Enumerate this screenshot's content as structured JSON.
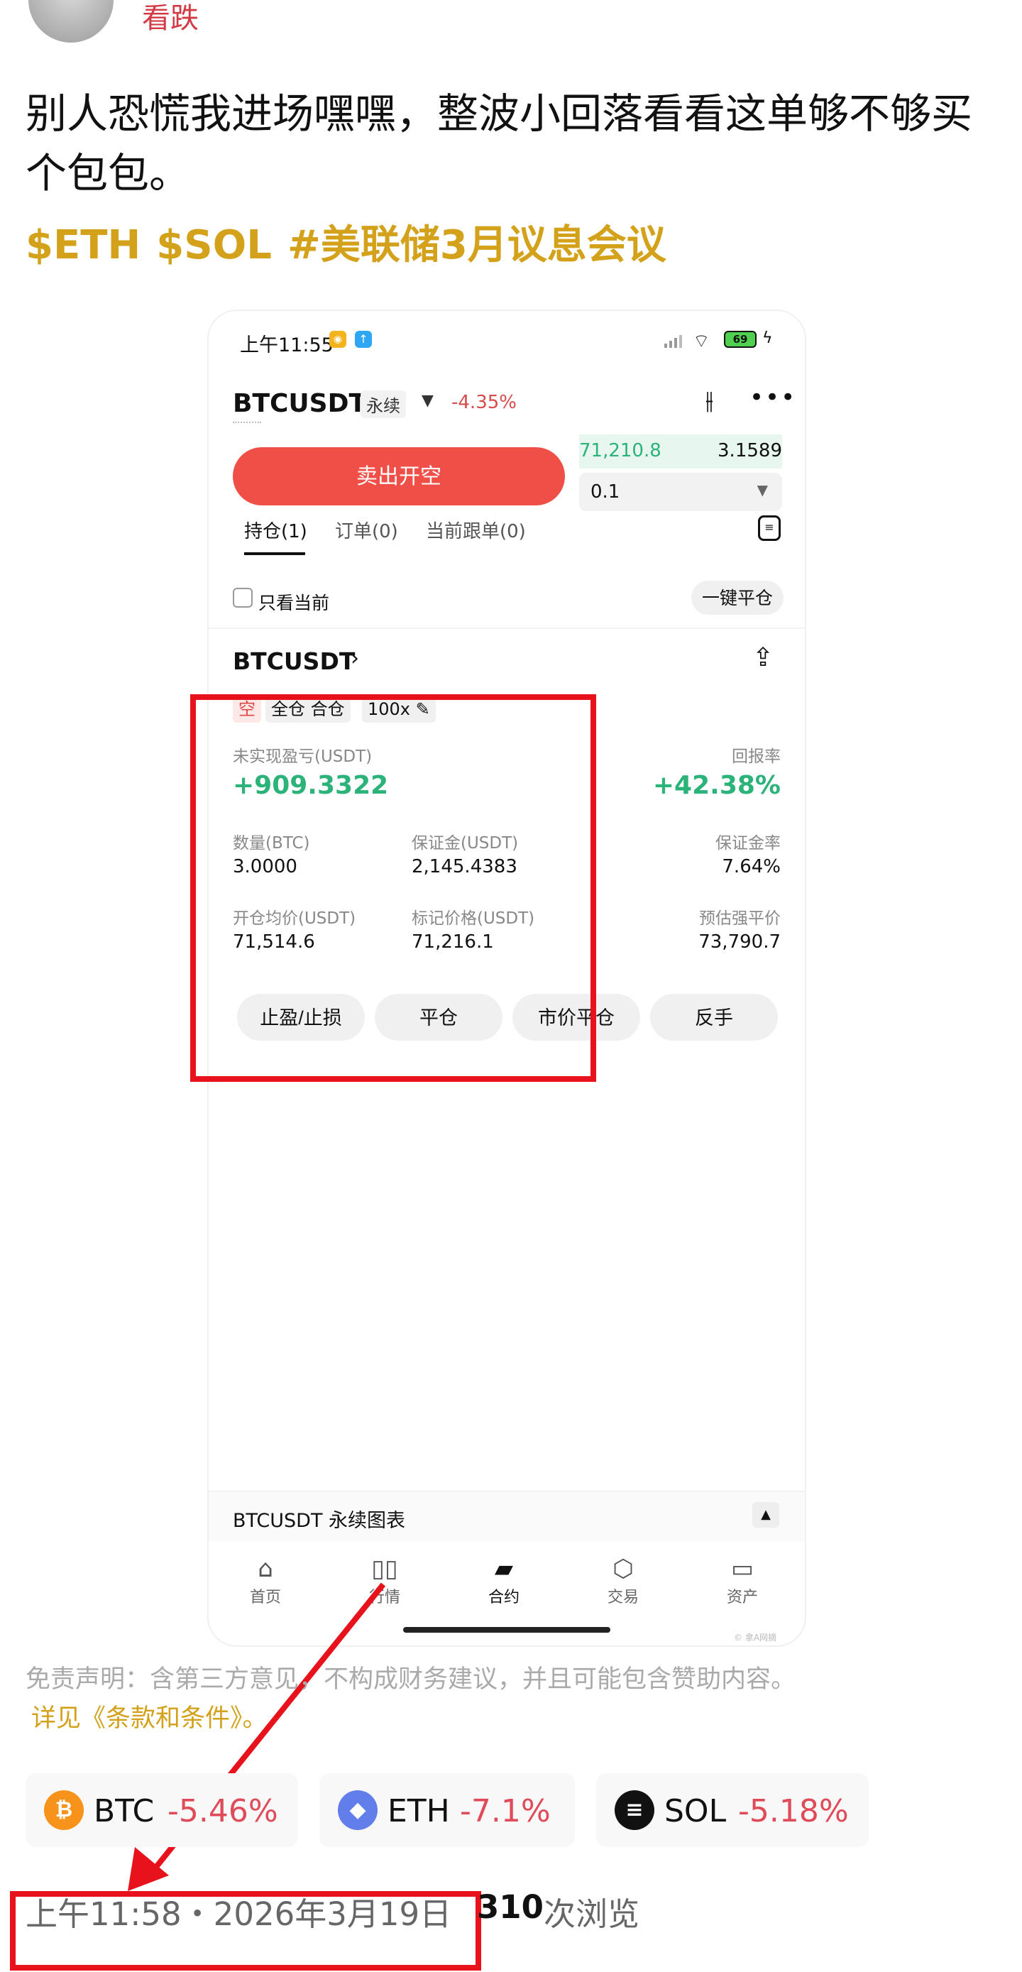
{
  "post": {
    "author": "看跌",
    "text": "别人恐慌我进场嘿嘿，整波小回落看看这单够不够买个包包。",
    "tags": [
      "$ETH",
      "$SOL",
      "#美联储3月议息会议"
    ]
  },
  "phone": {
    "status_time": "上午11:55",
    "battery": "69",
    "header": {
      "pair": "BTCUSDT",
      "type": "永续",
      "change": "-4.35%"
    },
    "orderbook": {
      "price": "71,210.8",
      "qty": "3.1589"
    },
    "sell_button": "卖出开空",
    "qty_value": "0.1",
    "tabs": [
      "持仓(1)",
      "订单(0)",
      "当前跟单(0)"
    ],
    "only_current": "只看当前",
    "close_all": "一键平仓",
    "position": {
      "symbol": "BTCUSDT",
      "side": "空",
      "margin_mode": "全仓 合仓",
      "leverage": "100x",
      "unrealized_label": "未实现盈亏(USDT)",
      "unrealized_value": "+909.3322",
      "roe_label": "回报率",
      "roe_value": "+42.38%",
      "qty_label": "数量(BTC)",
      "qty_value": "3.0000",
      "margin_label": "保证金(USDT)",
      "margin_value": "2,145.4383",
      "margin_ratio_label": "保证金率",
      "margin_ratio_value": "7.64%",
      "entry_label": "开仓均价(USDT)",
      "entry_value": "71,514.6",
      "mark_label": "标记价格(USDT)",
      "mark_value": "71,216.1",
      "liq_label": "预估强平价",
      "liq_value": "73,790.7",
      "actions": [
        "止盈/止损",
        "平仓",
        "市价平仓",
        "反手"
      ]
    },
    "chart_label": "BTCUSDT 永续图表",
    "nav": [
      "首页",
      "行情",
      "合约",
      "交易",
      "资产"
    ],
    "watermark": "© 拿A网摘"
  },
  "disclaimer": "免责声明：含第三方意见，不构成财务建议，并且可能包含赞助内容。",
  "terms": "详见《条款和条件》。",
  "coins": [
    {
      "name": "BTC",
      "change": "-5.46%",
      "color": "#f7931a",
      "icon": "₿"
    },
    {
      "name": "ETH",
      "change": "-7.1%",
      "color": "#627eea",
      "icon": "◆"
    },
    {
      "name": "SOL",
      "change": "-5.18%",
      "color": "#111111",
      "icon": "≡"
    }
  ],
  "footer": {
    "datetime": "上午11:58・2026年3月19日",
    "views_num": "310",
    "views_text": "次浏览"
  }
}
